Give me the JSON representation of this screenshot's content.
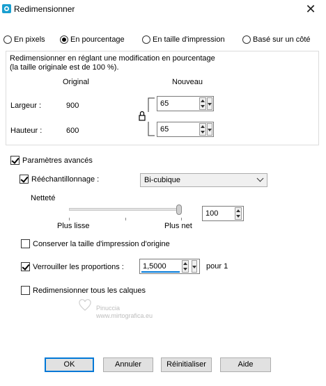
{
  "window": {
    "title": "Redimensionner",
    "close_glyph": "✕"
  },
  "mode_radios": [
    {
      "label": "En pixels",
      "selected": false
    },
    {
      "label": "En pourcentage",
      "selected": true
    },
    {
      "label": "En taille d'impression",
      "selected": false
    },
    {
      "label": "Basé sur un côté",
      "selected": false
    }
  ],
  "group": {
    "title_line1": "Redimensionner en réglant une modification en pourcentage",
    "title_line2": "(la taille originale est de 100 %).",
    "col_original": "Original",
    "col_new": "Nouveau",
    "width_label": "Largeur :",
    "width_original": "900",
    "width_new": "65",
    "height_label": "Hauteur :",
    "height_original": "600",
    "height_new": "65",
    "lock_icon": "padlock-icon"
  },
  "advanced": {
    "params_label": "Paramètres avancés",
    "params_checked": true,
    "resample_label": "Rééchantillonnage :",
    "resample_checked": true,
    "resample_value": "Bi-cubique",
    "sharpness_label": "Netteté",
    "sharpness_value": "100",
    "sharpness_fraction": 1.0,
    "smoother_label": "Plus lisse",
    "sharper_label": "Plus net",
    "keep_print_label": "Conserver la taille d'impression d'origine",
    "keep_print_checked": false,
    "lock_ratio_label": "Verrouiller les proportions :",
    "lock_ratio_checked": true,
    "ratio_value": "1,5000",
    "ratio_suffix": "pour 1",
    "all_layers_label": "Redimensionner tous les calques",
    "all_layers_checked": false
  },
  "watermark": {
    "line1": "Pinuccia",
    "line2": "www.mirtografica.eu"
  },
  "buttons": {
    "ok": "OK",
    "cancel": "Annuler",
    "reset": "Réinitialiser",
    "help": "Aide"
  },
  "colors": {
    "accent": "#0078d7",
    "field_border": "#7a7a7a"
  }
}
